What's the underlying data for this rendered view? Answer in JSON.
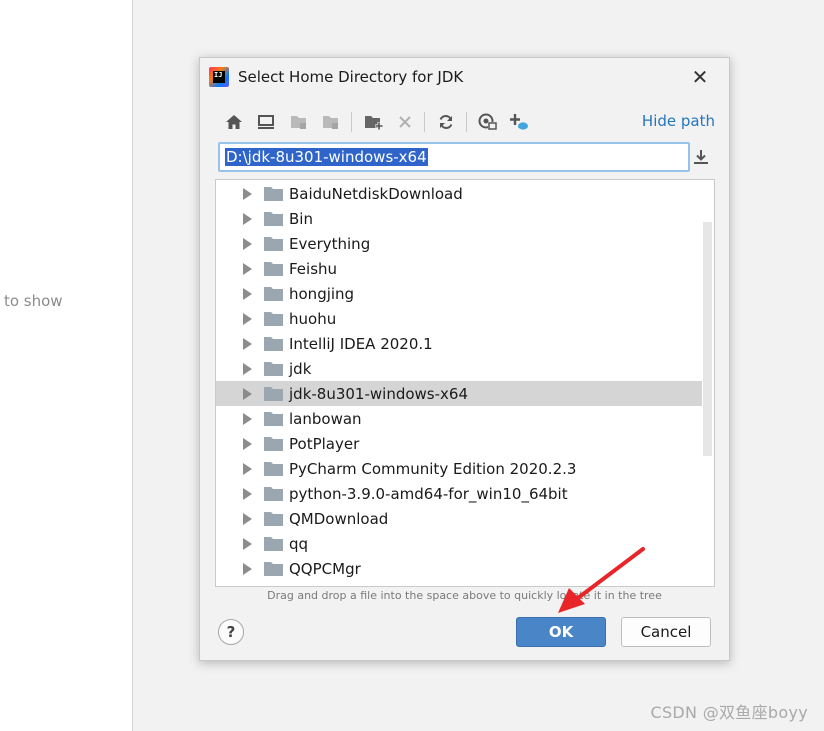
{
  "background": {
    "empty_text": "ing to show"
  },
  "watermark": "CSDN @双鱼座boyy",
  "dialog": {
    "title": "Select Home Directory for JDK",
    "close_glyph": "✕",
    "toolbar": {
      "icons": [
        "home-icon",
        "desktop-icon",
        "project-folder-icon",
        "module-folder-icon",
        "new-folder-icon",
        "delete-icon",
        "refresh-icon",
        "show-hidden-icon",
        "link-icon"
      ],
      "hide_path_label": "Hide path"
    },
    "path": {
      "value": "D:\\jdk-8u301-windows-x64"
    },
    "tree": {
      "items": [
        {
          "label": "BaiduNetdiskDownload",
          "selected": false
        },
        {
          "label": "Bin",
          "selected": false
        },
        {
          "label": "Everything",
          "selected": false
        },
        {
          "label": "Feishu",
          "selected": false
        },
        {
          "label": "hongjing",
          "selected": false
        },
        {
          "label": "huohu",
          "selected": false
        },
        {
          "label": "IntelliJ IDEA 2020.1",
          "selected": false
        },
        {
          "label": "jdk",
          "selected": false
        },
        {
          "label": "jdk-8u301-windows-x64",
          "selected": true
        },
        {
          "label": "lanbowan",
          "selected": false
        },
        {
          "label": "PotPlayer",
          "selected": false
        },
        {
          "label": "PyCharm Community Edition 2020.2.3",
          "selected": false
        },
        {
          "label": "python-3.9.0-amd64-for_win10_64bit",
          "selected": false
        },
        {
          "label": "QMDownload",
          "selected": false
        },
        {
          "label": "qq",
          "selected": false
        },
        {
          "label": "QQPCMgr",
          "selected": false
        }
      ]
    },
    "hint": "Drag and drop a file into the space above to quickly locate it in the tree",
    "help_label": "?",
    "ok_label": "OK",
    "cancel_label": "Cancel"
  },
  "colors": {
    "accent": "#4a86c7",
    "link": "#2675bf",
    "selection": "#2f65ca",
    "folder": "#9aa7b0",
    "annotation": "#e8262a"
  }
}
